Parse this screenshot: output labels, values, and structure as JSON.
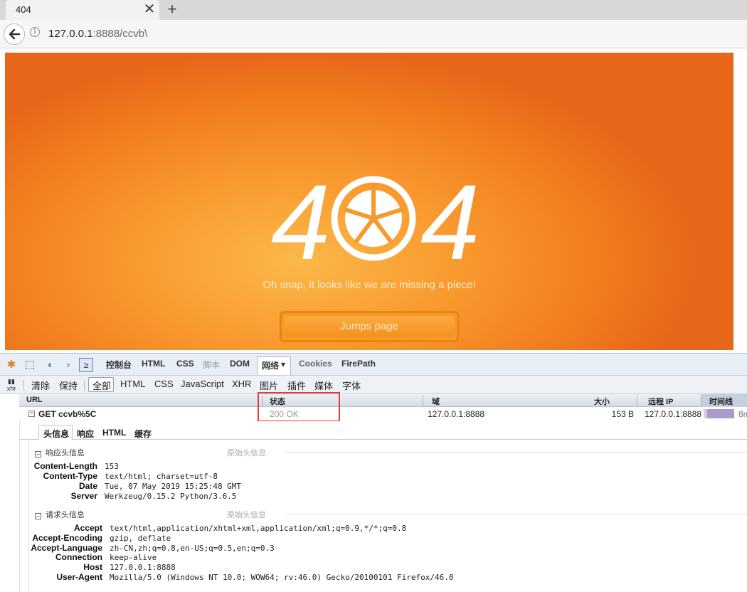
{
  "browser": {
    "tab_title": "404",
    "tab_close": "✕",
    "new_tab": "+",
    "url_host": "127.0.0.1",
    "url_rest": ":8888/ccvb\\"
  },
  "page": {
    "logo_text_left": "4",
    "logo_text_right": "4",
    "message": "Oh snap, it looks like we are missing a piece!",
    "button_label": "Jumps page",
    "colors": {
      "background": "#f7942a",
      "button": "#f49020"
    }
  },
  "firebug": {
    "tabs": [
      "控制台",
      "HTML",
      "CSS",
      "脚本",
      "DOM",
      "网络",
      "Cookies",
      "FirePath"
    ],
    "net_dropdown": "▾",
    "toolbar2": {
      "clear": "清除",
      "persist": "保持",
      "filters": [
        "全部",
        "HTML",
        "CSS",
        "JavaScript",
        "XHR",
        "图片",
        "插件",
        "媒体",
        "字体"
      ]
    },
    "columns": {
      "url": "URL",
      "status": "状态",
      "domain": "域",
      "size": "大小",
      "remote_ip": "远程 IP",
      "timeline": "时间线"
    },
    "request": {
      "url": "GET ccvb%5C",
      "status": "200 OK",
      "domain": "127.0.0.1:8888",
      "size": "153 B",
      "remote_ip": "127.0.0.1:8888",
      "time": "8m"
    },
    "detail_tabs": [
      "头信息",
      "响应",
      "HTML",
      "缓存"
    ],
    "response_headers": {
      "title": "响应头信息",
      "raw": "原始头信息",
      "rows": [
        {
          "name": "Content-Length",
          "value": "153"
        },
        {
          "name": "Content-Type",
          "value": "text/html; charset=utf-8"
        },
        {
          "name": "Date",
          "value": "Tue, 07 May 2019 15:25:48 GMT"
        },
        {
          "name": "Server",
          "value": "Werkzeug/0.15.2 Python/3.6.5"
        }
      ]
    },
    "request_headers": {
      "title": "请求头信息",
      "raw": "原始头信息",
      "rows": [
        {
          "name": "Accept",
          "value": "text/html,application/xhtml+xml,application/xml;q=0.9,*/*;q=0.8"
        },
        {
          "name": "Accept-Encoding",
          "value": "gzip, deflate"
        },
        {
          "name": "Accept-Language",
          "value": "zh-CN,zh;q=0.8,en-US;q=0.5,en;q=0.3"
        },
        {
          "name": "Connection",
          "value": "keep-alive"
        },
        {
          "name": "Host",
          "value": "127.0.0.1:8888"
        },
        {
          "name": "User-Agent",
          "value": "Mozilla/5.0 (Windows NT 10.0; WOW64; rv:46.0) Gecko/20100101 Firefox/46.0"
        }
      ]
    }
  }
}
